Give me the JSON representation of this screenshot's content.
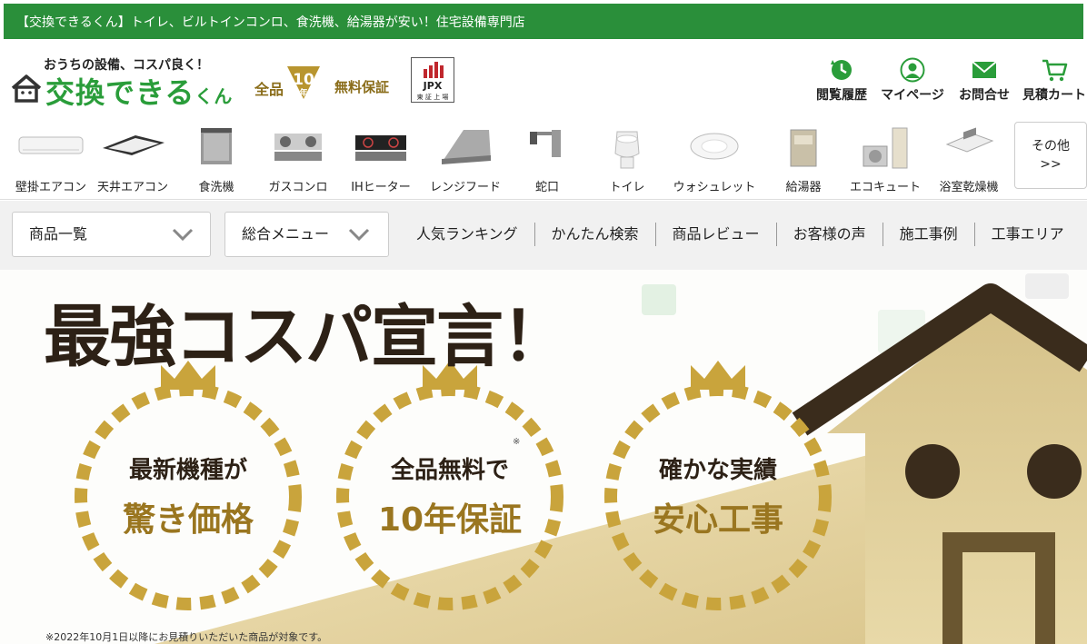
{
  "topbar": {
    "text": "【交換できるくん】トイレ、ビルトインコンロ、食洗機、給湯器が安い！住宅設備専門店"
  },
  "logo": {
    "tagline": "おうちの設備、コスパ良く！",
    "brand": "交換できる",
    "brand_suffix": "くん"
  },
  "warranty": {
    "prefix": "全品",
    "years": "10",
    "unit": "年",
    "suffix": "無料保証"
  },
  "jpx": {
    "label": "JPX",
    "sub": "東 証 上 場"
  },
  "header_nav": [
    {
      "label": "閲覧履歴",
      "icon": "history-icon"
    },
    {
      "label": "マイページ",
      "icon": "user-icon"
    },
    {
      "label": "お問合せ",
      "icon": "mail-icon"
    },
    {
      "label": "見積カート",
      "icon": "cart-icon"
    }
  ],
  "categories": [
    {
      "label": "壁掛エアコン",
      "icon": "wall-aircon-icon"
    },
    {
      "label": "天井エアコン",
      "icon": "ceiling-aircon-icon"
    },
    {
      "label": "食洗機",
      "icon": "dishwasher-icon"
    },
    {
      "label": "ガスコンロ",
      "icon": "gas-stove-icon"
    },
    {
      "label": "IHヒーター",
      "icon": "ih-heater-icon"
    },
    {
      "label": "レンジフード",
      "icon": "range-hood-icon"
    },
    {
      "label": "蛇口",
      "icon": "faucet-icon"
    },
    {
      "label": "トイレ",
      "icon": "toilet-icon"
    },
    {
      "label": "ウォシュレット",
      "icon": "washlet-icon"
    },
    {
      "label": "給湯器",
      "icon": "water-heater-icon"
    },
    {
      "label": "エコキュート",
      "icon": "ecocute-icon"
    },
    {
      "label": "浴室乾燥機",
      "icon": "bath-dryer-icon"
    }
  ],
  "more": {
    "line1": "その他",
    "line2": ">>"
  },
  "dropdowns": {
    "products": "商品一覧",
    "menu": "総合メニュー"
  },
  "nav_links": [
    "人気ランキング",
    "かんたん検索",
    "商品レビュー",
    "お客様の声",
    "施工事例",
    "工事エリア"
  ],
  "hero": {
    "headline": "最強コスパ宣言！",
    "badges": [
      {
        "line1": "最新機種が",
        "line2": "驚き価格",
        "note": ""
      },
      {
        "line1": "全品無料で",
        "line2": "10年保証",
        "note": "※"
      },
      {
        "line1": "確かな実績",
        "line2": "安心工事",
        "note": ""
      }
    ],
    "disclaimer": "※2022年10月1日以降にお見積りいただいた商品が対象です。"
  },
  "colors": {
    "green": "#2a8f3a",
    "brand_green": "#2a9d3a",
    "gold": "#b8952f",
    "dark": "#2d2116"
  }
}
